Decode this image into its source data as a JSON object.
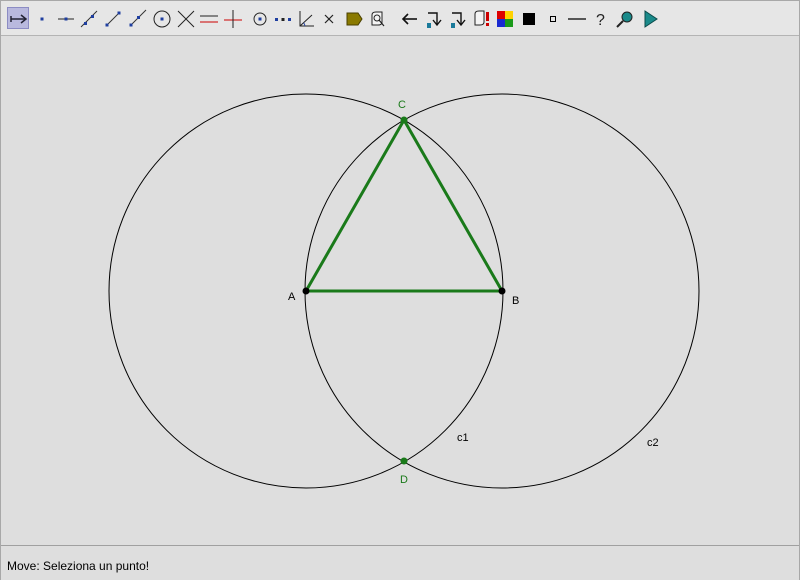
{
  "toolbar": {
    "tools": [
      {
        "id": "move",
        "icon": "move-arrow-icon",
        "active": true
      },
      {
        "id": "point",
        "icon": "point-icon"
      },
      {
        "id": "point-on-object",
        "icon": "point-on-line-icon"
      },
      {
        "id": "line",
        "icon": "line-icon"
      },
      {
        "id": "segment",
        "icon": "segment-icon"
      },
      {
        "id": "ray",
        "icon": "ray-icon"
      },
      {
        "id": "circle",
        "icon": "circle-icon"
      },
      {
        "id": "intersect",
        "icon": "intersect-icon"
      },
      {
        "id": "parallel",
        "icon": "parallel-icon"
      },
      {
        "id": "perpendicular",
        "icon": "perpendicular-icon"
      },
      {
        "id": "circle-center-point",
        "icon": "circle-center-icon"
      },
      {
        "id": "midpoint",
        "icon": "midpoint-icon"
      },
      {
        "id": "angle",
        "icon": "angle-icon"
      },
      {
        "id": "delete",
        "icon": "delete-x-icon"
      },
      {
        "id": "polygon",
        "icon": "polygon-icon"
      },
      {
        "id": "macro",
        "icon": "macro-icon"
      },
      {
        "id": "undo",
        "icon": "undo-arrow-icon"
      },
      {
        "id": "redo-1",
        "icon": "redo-down-icon"
      },
      {
        "id": "redo-2",
        "icon": "redo-down-icon"
      },
      {
        "id": "macro-warning",
        "icon": "macro-warning-icon"
      },
      {
        "id": "color",
        "icon": "color-palette-icon"
      },
      {
        "id": "fill",
        "icon": "fill-square-icon"
      },
      {
        "id": "point-style",
        "icon": "small-square-icon"
      },
      {
        "id": "line-style",
        "icon": "line-style-icon"
      },
      {
        "id": "help",
        "icon": "question-icon"
      },
      {
        "id": "zoom",
        "icon": "magnifier-icon"
      },
      {
        "id": "run",
        "icon": "play-icon"
      }
    ]
  },
  "construction": {
    "points": [
      {
        "id": "A",
        "label": "A",
        "color": "#000000"
      },
      {
        "id": "B",
        "label": "B",
        "color": "#000000"
      },
      {
        "id": "C",
        "label": "C",
        "color": "#1a7a1a"
      },
      {
        "id": "D",
        "label": "D",
        "color": "#1a7a1a"
      }
    ],
    "circles": [
      {
        "id": "c1",
        "label": "c1",
        "center": "A",
        "through": "B"
      },
      {
        "id": "c2",
        "label": "c2",
        "center": "B",
        "through": "A"
      }
    ],
    "triangle": {
      "vertices": [
        "A",
        "B",
        "C"
      ],
      "color": "#1a7a1a"
    }
  },
  "status": {
    "text": "Move: Seleziona un punto!"
  },
  "colors": {
    "green": "#1a7a1a",
    "black": "#000000",
    "background": "#dedede",
    "active_tool": "#b9b9de"
  }
}
